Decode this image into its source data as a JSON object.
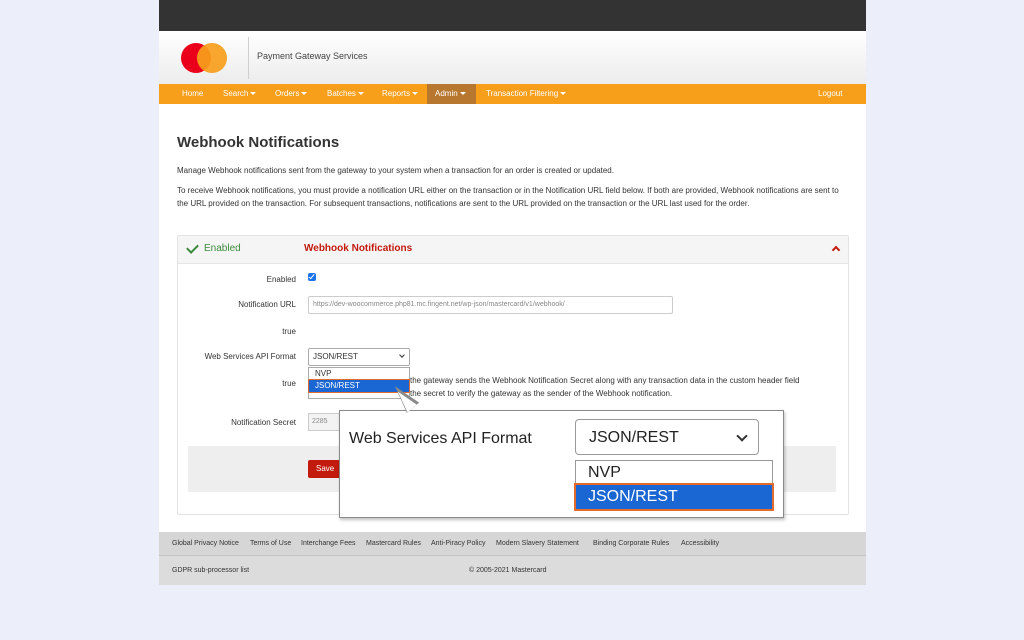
{
  "header": {
    "brand": "Payment Gateway Services"
  },
  "nav": {
    "items": [
      "Home",
      "Search",
      "Orders",
      "Batches",
      "Reports",
      "Admin",
      "Transaction Filtering"
    ],
    "logout": "Logout"
  },
  "page": {
    "title": "Webhook Notifications",
    "intro1": "Manage Webhook notifications sent from the gateway to your system when a transaction for an order is created or updated.",
    "intro2": "To receive Webhook notifications, you must provide a notification URL either on the transaction or in the Notification URL field below. If both are provided, Webhook notifications are sent to the URL provided on the transaction. For subsequent transactions, notifications are sent to the URL provided on the transaction or the URL last used for the order."
  },
  "panel": {
    "status": "Enabled",
    "title": "Webhook Notifications",
    "labels": {
      "enabled": "Enabled",
      "notification_url": "Notification URL",
      "true1": "true",
      "api_format": "Web Services API Format",
      "true2": "true",
      "secret": "Notification Secret"
    },
    "notification_url_value": "https://dev-woocommerce.php81.mc.fingent.net/wp-json/mastercard/v1/webhook/",
    "api_format_value": "JSON/REST",
    "options": [
      "NVP",
      "JSON/REST"
    ],
    "desc_line1": "the gateway sends the Webhook Notification Secret along with any transaction data in the custom header field",
    "desc_line2": "the secret to verify the gateway as the sender of the Webhook notification.",
    "secret_value": "2285",
    "save_label": "Save"
  },
  "zoom": {
    "label": "Web Services API Format",
    "selected": "JSON/REST",
    "options": [
      "NVP",
      "JSON/REST"
    ]
  },
  "footer": {
    "links": [
      "Global Privacy Notice",
      "Terms of Use",
      "Interchange Fees",
      "Mastercard Rules",
      "Anti-Piracy Policy",
      "Modern Slavery Statement",
      "Binding Corporate Rules",
      "Accessibility"
    ],
    "subprocessor": "GDPR sub-processor list",
    "copyright": "© 2005-2021 Mastercard"
  }
}
